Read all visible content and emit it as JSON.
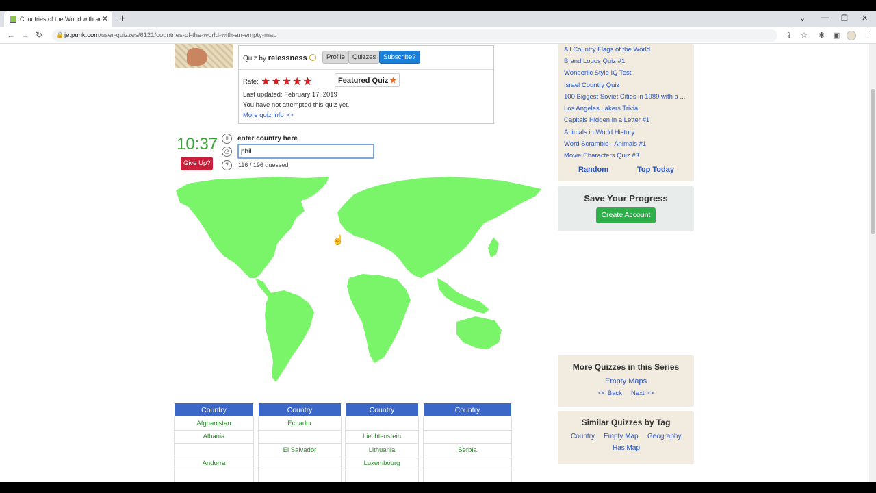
{
  "browser": {
    "tab_title": "Countries of the World with an E",
    "url_host": "jetpunk.com",
    "url_path": "/user-quizzes/6121/countries-of-the-world-with-an-empty-map"
  },
  "quiz_info": {
    "quiz_by_prefix": "Quiz by",
    "author": "relessness",
    "profile_label": "Profile",
    "quizzes_label": "Quizzes",
    "subscribe_label": "Subscribe?",
    "rate_label": "Rate:",
    "stars": "★★★★★",
    "featured_label": "Featured Quiz",
    "last_updated": "Last updated: February 17, 2019",
    "attempt_status": "You have not attempted this quiz yet.",
    "more_info": "More quiz info >>"
  },
  "game": {
    "timer": "10:37",
    "give_up": "Give Up?",
    "enter_label": "enter country here",
    "answer_value": "phil",
    "guessed": "116 / 196 guessed",
    "map_fill": "#7af56a"
  },
  "table": {
    "header": "Country",
    "columns": [
      [
        "Afghanistan",
        "Albania",
        "",
        "Andorra",
        ""
      ],
      [
        "Ecuador",
        "",
        "El Salvador",
        "",
        ""
      ],
      [
        "",
        "Liechtenstein",
        "Lithuania",
        "Luxembourg",
        ""
      ],
      [
        "",
        "",
        "Serbia",
        "",
        ""
      ]
    ]
  },
  "sidebar": {
    "related": [
      "All Country Flags of the World",
      "Brand Logos Quiz #1",
      "Wonderlic Style IQ Test",
      "Israel Country Quiz",
      "100 Biggest Soviet Cities in 1989 with a ...",
      "Los Angeles Lakers Trivia",
      "Capitals Hidden in a Letter #1",
      "Animals in World History",
      "Word Scramble - Animals #1",
      "Movie Characters Quiz #3"
    ],
    "random": "Random",
    "top_today": "Top Today",
    "save_title": "Save Your Progress",
    "create_account": "Create Account",
    "series_title": "More Quizzes in this Series",
    "series_link": "Empty Maps",
    "series_back": "<< Back",
    "series_next": "Next >>",
    "similar_title": "Similar Quizzes by Tag",
    "tags": [
      "Country",
      "Empty Map",
      "Geography",
      "Has Map"
    ]
  }
}
